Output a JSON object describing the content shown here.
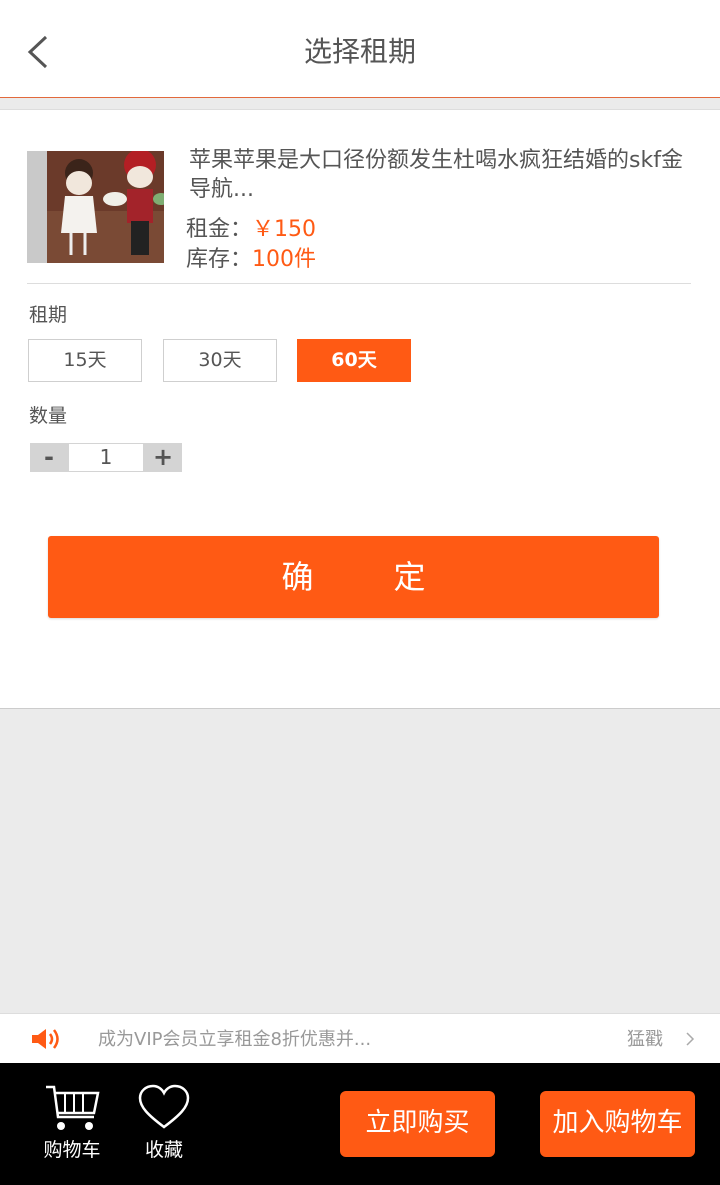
{
  "header": {
    "title": "选择租期"
  },
  "product": {
    "name": "苹果苹果是大口径份额发生杜喝水疯狂结婚的skf金导航...",
    "price_label": "租金：",
    "price_value": "￥150",
    "stock_label": "库存：",
    "stock_value": "100件"
  },
  "period": {
    "label": "租期",
    "options": [
      "15天",
      "30天",
      "60天"
    ],
    "selected": "60天"
  },
  "quantity": {
    "label": "数量",
    "minus": "-",
    "plus": "+",
    "value": "1"
  },
  "confirm_label": "确定",
  "notice": {
    "text": "成为VIP会员立享租金8折优惠并...",
    "link": "猛戳"
  },
  "bottom": {
    "cart_tab": "购物车",
    "fav_tab": "收藏",
    "buy_now": "立即购买",
    "add_to_cart": "加入购物车"
  },
  "colors": {
    "accent": "#ff5a14",
    "background": "#ebebeb",
    "bottom_bar": "#000000"
  },
  "icons": [
    "back-icon",
    "speaker-icon",
    "chevron-right-icon",
    "cart-icon",
    "heart-icon"
  ]
}
